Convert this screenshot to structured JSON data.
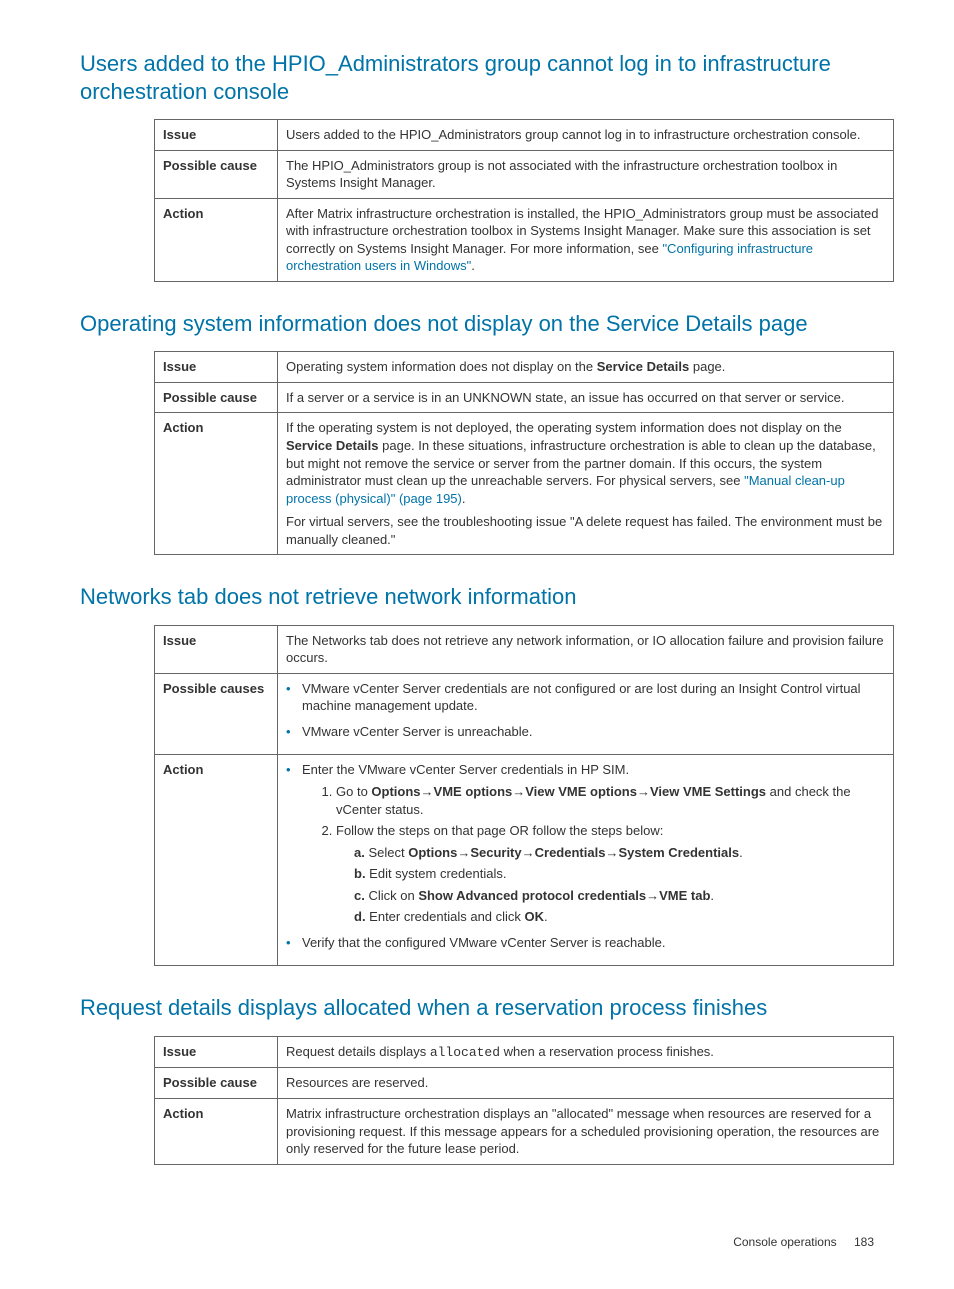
{
  "sections": {
    "s1": {
      "heading": "Users added to the HPIO_Administrators group cannot log in to infrastructure orchestration console",
      "issue_label": "Issue",
      "issue_text": "Users added to the HPIO_Administrators group cannot log in to infrastructure orchestration console.",
      "cause_label": "Possible cause",
      "cause_text": "The HPIO_Administrators group is not associated with the infrastructure orchestration toolbox in Systems Insight Manager.",
      "action_label": "Action",
      "action_pre": "After Matrix infrastructure orchestration is installed, the HPIO_Administrators group must be associated with infrastructure orchestration toolbox in Systems Insight Manager. Make sure this association is set correctly on Systems Insight Manager. For more information, see ",
      "action_link": "\"Configuring infrastructure orchestration users in Windows\"",
      "action_post": "."
    },
    "s2": {
      "heading": "Operating system information does not display on the Service Details page",
      "issue_label": "Issue",
      "issue_pre": "Operating system information does not display on the ",
      "issue_bold": "Service Details",
      "issue_post": " page.",
      "cause_label": "Possible cause",
      "cause_text": "If a server or a service is in an UNKNOWN state, an issue has occurred on that server or service.",
      "action_label": "Action",
      "action_p1a": "If the operating system is not deployed, the operating system information does not display on the ",
      "action_p1_bold": "Service Details",
      "action_p1b": " page. In these situations, infrastructure orchestration is able to clean up the database, but might not remove the service or server from the partner domain. If this occurs, the system administrator must clean up the unreachable servers. For physical servers, see ",
      "action_link": "\"Manual clean-up process (physical)\" (page 195)",
      "action_p1c": ".",
      "action_p2": "For virtual servers, see the troubleshooting issue \"A delete request has failed. The environment must be manually cleaned.\""
    },
    "s3": {
      "heading": "Networks tab does not retrieve network information",
      "issue_label": "Issue",
      "issue_text": "The Networks tab does not retrieve any network information, or IO allocation failure and provision failure occurs.",
      "cause_label": "Possible causes",
      "cause_b1": "VMware vCenter Server credentials are not configured or are lost during an Insight Control virtual machine management update.",
      "cause_b2": "VMware vCenter Server is unreachable.",
      "action_label": "Action",
      "act_b1": "Enter the VMware vCenter Server credentials in HP SIM.",
      "act_n1_pre": "Go to ",
      "act_n1_b1": "Options",
      "act_n1_arr1": "→",
      "act_n1_b2": "VME options",
      "act_n1_arr2": "→",
      "act_n1_b3": "View VME options",
      "act_n1_arr3": "→",
      "act_n1_b4": "View VME Settings",
      "act_n1_post": " and check the vCenter status.",
      "act_n2": "Follow the steps on that page OR follow the steps below:",
      "act_a_label": "a.",
      "act_a_pre": " Select ",
      "act_a_b1": "Options",
      "act_a_arr1": "→",
      "act_a_b2": "Security",
      "act_a_arr2": "→",
      "act_a_b3": "Credentials",
      "act_a_arr3": "→",
      "act_a_b4": "System Credentials",
      "act_a_post": ".",
      "act_b_label": "b.",
      "act_b_text": " Edit system credentials.",
      "act_c_label": "c.",
      "act_c_pre": " Click on ",
      "act_c_b1": "Show Advanced protocol credentials",
      "act_c_arr": "→",
      "act_c_b2": "VME tab",
      "act_c_post": ".",
      "act_d_label": "d.",
      "act_d_pre": " Enter credentials and click ",
      "act_d_b1": "OK",
      "act_d_post": ".",
      "act_b2_text": "Verify that the configured VMware vCenter Server is reachable."
    },
    "s4": {
      "heading": "Request details displays allocated when a reservation process finishes",
      "issue_label": "Issue",
      "issue_pre": "Request details displays ",
      "issue_code": "allocated",
      "issue_post": " when a reservation process finishes.",
      "cause_label": "Possible cause",
      "cause_text": "Resources are reserved.",
      "action_label": "Action",
      "action_text": "Matrix infrastructure orchestration displays an \"allocated\" message when resources are reserved for a provisioning request. If this message appears for a scheduled provisioning operation, the resources are only reserved for the future lease period."
    }
  },
  "footer": {
    "text": "Console operations",
    "page": "183"
  }
}
